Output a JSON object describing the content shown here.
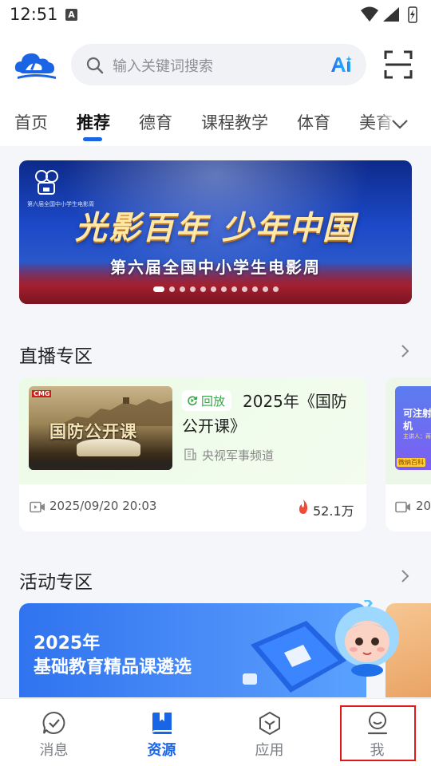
{
  "status_bar": {
    "time": "12:51",
    "indicator": "A"
  },
  "header": {
    "search_placeholder": "输入关键词搜索",
    "ai_label": "Ai",
    "icons": [
      "logo-icon",
      "search-icon",
      "ai-icon",
      "scan-icon"
    ]
  },
  "tabs": [
    {
      "label": "首页",
      "active": false
    },
    {
      "label": "推荐",
      "active": true
    },
    {
      "label": "德育",
      "active": false
    },
    {
      "label": "课程教学",
      "active": false
    },
    {
      "label": "体育",
      "active": false
    },
    {
      "label": "美育",
      "active": false
    }
  ],
  "banner": {
    "title": "光影百年  少年中国",
    "subtitle": "第六届全国中小学生电影周",
    "small_text": "第六届全国中小学生电影周",
    "slide_count": 12,
    "active_slide": 0
  },
  "live_section": {
    "title": "直播专区",
    "cards": [
      {
        "thumb_logo": "CMG",
        "thumb_text": "国防公开课",
        "badge": "回放",
        "title": "2025年《国防公开课》",
        "channel": "央视军事频道",
        "time": "2025/09/20 20:03",
        "views": "52.1万"
      },
      {
        "thumb_text": "可注射纳米机",
        "thumb_small": "主讲人：蒋",
        "thumb_tag": "微纳百科",
        "time": "20"
      }
    ]
  },
  "activity_section": {
    "title": "活动专区",
    "banner_line1": "2025年",
    "banner_line2": "基础教育精品课遴选"
  },
  "bottom_nav": [
    {
      "label": "消息",
      "icon": "message-icon",
      "active": false
    },
    {
      "label": "资源",
      "icon": "book-icon",
      "active": true
    },
    {
      "label": "应用",
      "icon": "cube-icon",
      "active": false
    },
    {
      "label": "我",
      "icon": "profile-icon",
      "active": false,
      "highlighted": true
    }
  ],
  "colors": {
    "accent": "#1a64e6",
    "replay_green": "#3aa548",
    "fire": "#f04a3a",
    "highlight_box": "#e01818"
  }
}
